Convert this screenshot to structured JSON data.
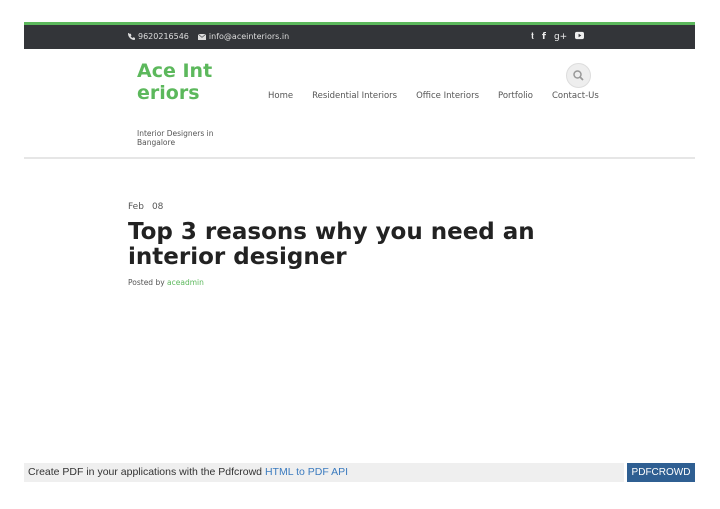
{
  "topbar": {
    "phone": "9620216546",
    "email": "info@aceinteriors.in",
    "social": [
      "twitter-icon",
      "facebook-icon",
      "google-plus-icon",
      "youtube-icon"
    ]
  },
  "header": {
    "logo": "Ace Interiors",
    "tagline": "Interior Designers in Bangalore"
  },
  "nav": {
    "items": [
      {
        "label": "Home"
      },
      {
        "label": "Residential Interiors"
      },
      {
        "label": "Office Interiors"
      },
      {
        "label": "Portfolio"
      },
      {
        "label": "Contact-Us"
      }
    ]
  },
  "post": {
    "month": "Feb",
    "day": "08",
    "title": "Top 3 reasons why you need an interior designer",
    "posted_by_label": "Posted by",
    "author": "aceadmin"
  },
  "pdfcrowd": {
    "text": "Create PDF in your applications with the Pdfcrowd",
    "link": "HTML to PDF API",
    "button": "PDFCROWD"
  },
  "colors": {
    "accent": "#5cb85c",
    "topbar": "#333539",
    "pdf_button": "#2f5f92"
  }
}
